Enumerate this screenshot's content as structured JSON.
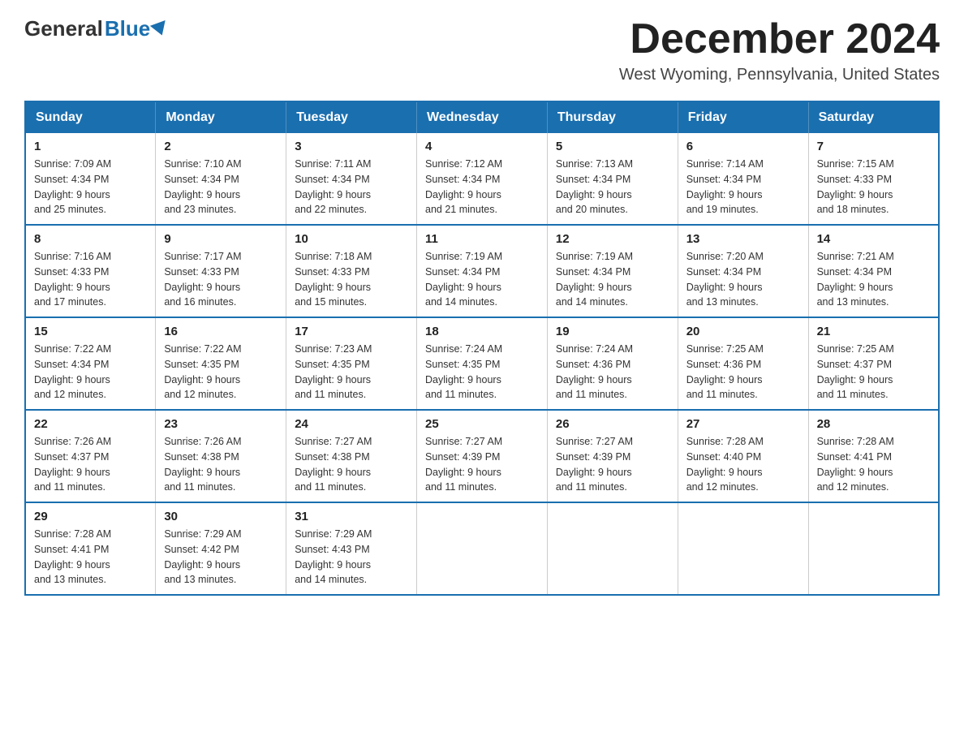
{
  "logo": {
    "general_text": "General",
    "blue_text": "Blue"
  },
  "header": {
    "month_title": "December 2024",
    "location": "West Wyoming, Pennsylvania, United States"
  },
  "days_of_week": [
    "Sunday",
    "Monday",
    "Tuesday",
    "Wednesday",
    "Thursday",
    "Friday",
    "Saturday"
  ],
  "weeks": [
    [
      {
        "day": "1",
        "sunrise": "7:09 AM",
        "sunset": "4:34 PM",
        "daylight": "9 hours and 25 minutes."
      },
      {
        "day": "2",
        "sunrise": "7:10 AM",
        "sunset": "4:34 PM",
        "daylight": "9 hours and 23 minutes."
      },
      {
        "day": "3",
        "sunrise": "7:11 AM",
        "sunset": "4:34 PM",
        "daylight": "9 hours and 22 minutes."
      },
      {
        "day": "4",
        "sunrise": "7:12 AM",
        "sunset": "4:34 PM",
        "daylight": "9 hours and 21 minutes."
      },
      {
        "day": "5",
        "sunrise": "7:13 AM",
        "sunset": "4:34 PM",
        "daylight": "9 hours and 20 minutes."
      },
      {
        "day": "6",
        "sunrise": "7:14 AM",
        "sunset": "4:34 PM",
        "daylight": "9 hours and 19 minutes."
      },
      {
        "day": "7",
        "sunrise": "7:15 AM",
        "sunset": "4:33 PM",
        "daylight": "9 hours and 18 minutes."
      }
    ],
    [
      {
        "day": "8",
        "sunrise": "7:16 AM",
        "sunset": "4:33 PM",
        "daylight": "9 hours and 17 minutes."
      },
      {
        "day": "9",
        "sunrise": "7:17 AM",
        "sunset": "4:33 PM",
        "daylight": "9 hours and 16 minutes."
      },
      {
        "day": "10",
        "sunrise": "7:18 AM",
        "sunset": "4:33 PM",
        "daylight": "9 hours and 15 minutes."
      },
      {
        "day": "11",
        "sunrise": "7:19 AM",
        "sunset": "4:34 PM",
        "daylight": "9 hours and 14 minutes."
      },
      {
        "day": "12",
        "sunrise": "7:19 AM",
        "sunset": "4:34 PM",
        "daylight": "9 hours and 14 minutes."
      },
      {
        "day": "13",
        "sunrise": "7:20 AM",
        "sunset": "4:34 PM",
        "daylight": "9 hours and 13 minutes."
      },
      {
        "day": "14",
        "sunrise": "7:21 AM",
        "sunset": "4:34 PM",
        "daylight": "9 hours and 13 minutes."
      }
    ],
    [
      {
        "day": "15",
        "sunrise": "7:22 AM",
        "sunset": "4:34 PM",
        "daylight": "9 hours and 12 minutes."
      },
      {
        "day": "16",
        "sunrise": "7:22 AM",
        "sunset": "4:35 PM",
        "daylight": "9 hours and 12 minutes."
      },
      {
        "day": "17",
        "sunrise": "7:23 AM",
        "sunset": "4:35 PM",
        "daylight": "9 hours and 11 minutes."
      },
      {
        "day": "18",
        "sunrise": "7:24 AM",
        "sunset": "4:35 PM",
        "daylight": "9 hours and 11 minutes."
      },
      {
        "day": "19",
        "sunrise": "7:24 AM",
        "sunset": "4:36 PM",
        "daylight": "9 hours and 11 minutes."
      },
      {
        "day": "20",
        "sunrise": "7:25 AM",
        "sunset": "4:36 PM",
        "daylight": "9 hours and 11 minutes."
      },
      {
        "day": "21",
        "sunrise": "7:25 AM",
        "sunset": "4:37 PM",
        "daylight": "9 hours and 11 minutes."
      }
    ],
    [
      {
        "day": "22",
        "sunrise": "7:26 AM",
        "sunset": "4:37 PM",
        "daylight": "9 hours and 11 minutes."
      },
      {
        "day": "23",
        "sunrise": "7:26 AM",
        "sunset": "4:38 PM",
        "daylight": "9 hours and 11 minutes."
      },
      {
        "day": "24",
        "sunrise": "7:27 AM",
        "sunset": "4:38 PM",
        "daylight": "9 hours and 11 minutes."
      },
      {
        "day": "25",
        "sunrise": "7:27 AM",
        "sunset": "4:39 PM",
        "daylight": "9 hours and 11 minutes."
      },
      {
        "day": "26",
        "sunrise": "7:27 AM",
        "sunset": "4:39 PM",
        "daylight": "9 hours and 11 minutes."
      },
      {
        "day": "27",
        "sunrise": "7:28 AM",
        "sunset": "4:40 PM",
        "daylight": "9 hours and 12 minutes."
      },
      {
        "day": "28",
        "sunrise": "7:28 AM",
        "sunset": "4:41 PM",
        "daylight": "9 hours and 12 minutes."
      }
    ],
    [
      {
        "day": "29",
        "sunrise": "7:28 AM",
        "sunset": "4:41 PM",
        "daylight": "9 hours and 13 minutes."
      },
      {
        "day": "30",
        "sunrise": "7:29 AM",
        "sunset": "4:42 PM",
        "daylight": "9 hours and 13 minutes."
      },
      {
        "day": "31",
        "sunrise": "7:29 AM",
        "sunset": "4:43 PM",
        "daylight": "9 hours and 14 minutes."
      },
      null,
      null,
      null,
      null
    ]
  ],
  "labels": {
    "sunrise_prefix": "Sunrise: ",
    "sunset_prefix": "Sunset: ",
    "daylight_prefix": "Daylight: "
  }
}
